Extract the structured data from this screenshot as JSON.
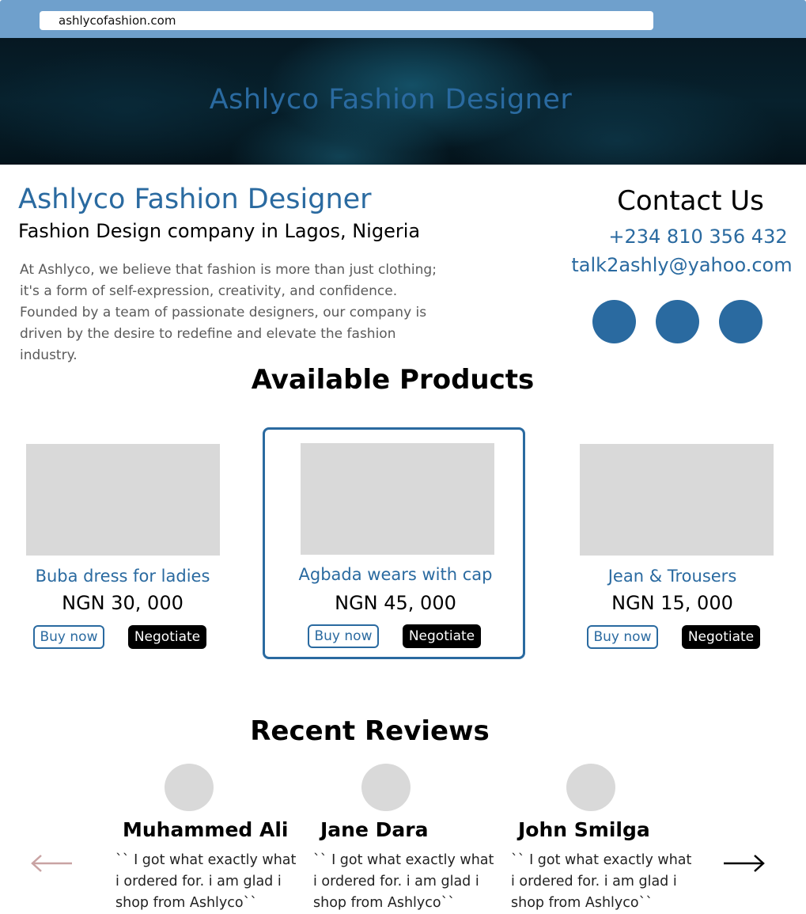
{
  "browser": {
    "url": "ashlycofashion.com"
  },
  "hero": {
    "title": "Ashlyco Fashion Designer"
  },
  "company": {
    "name": "Ashlyco Fashion Designer",
    "tagline": "Fashion Design company in Lagos, Nigeria",
    "about": "At Ashlyco, we believe that fashion is more than just clothing; it's a form of self-expression, creativity, and confidence. Founded by a team of passionate designers, our company is driven by the desire to redefine and elevate the fashion industry."
  },
  "contact": {
    "title": "Contact Us",
    "phone": "+234 810 356 432",
    "email": "talk2ashly@yahoo.com"
  },
  "products": {
    "title": "Available Products",
    "items": [
      {
        "name": "Buba dress for ladies",
        "price": "NGN 30, 000",
        "buy_label": "Buy now",
        "negotiate_label": "Negotiate"
      },
      {
        "name": "Agbada wears with cap",
        "price": "NGN 45, 000",
        "buy_label": "Buy now",
        "negotiate_label": "Negotiate"
      },
      {
        "name": "Jean & Trousers",
        "price": "NGN 15, 000",
        "buy_label": "Buy now",
        "negotiate_label": "Negotiate"
      }
    ]
  },
  "reviews": {
    "title": "Recent Reviews",
    "items": [
      {
        "name": "Muhammed Ali",
        "text": "`` I got what exactly what i ordered for. i am glad i shop from Ashlyco``"
      },
      {
        "name": "Jane Dara",
        "text": "`` I got what exactly what i ordered for. i am glad i shop from Ashlyco``"
      },
      {
        "name": "John Smilga",
        "text": "`` I got what exactly what i ordered for. i am glad i shop from Ashlyco``"
      }
    ]
  },
  "colors": {
    "brand_blue": "#2a6aa0",
    "browser_bar": "#6fa0cc",
    "placeholder_gray": "#d9d9d9",
    "arrow_prev": "#c9a3a3",
    "arrow_next": "#000000"
  },
  "icons": {
    "social": [
      "social-icon",
      "social-icon",
      "social-icon"
    ],
    "prev": "arrow-left-icon",
    "next": "arrow-right-icon"
  }
}
